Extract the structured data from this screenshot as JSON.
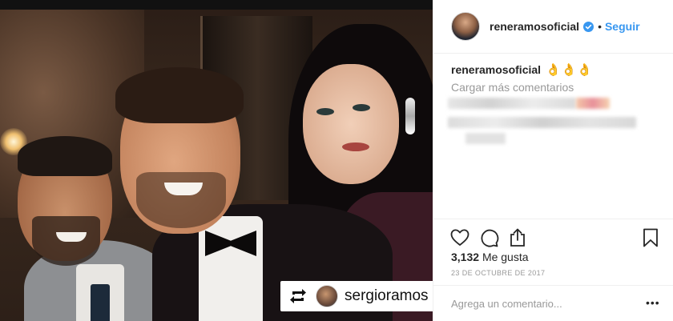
{
  "post": {
    "repost_username": "sergioramos"
  },
  "header": {
    "username": "reneramosoficial",
    "separator": "•",
    "follow_label": "Seguir"
  },
  "caption": {
    "username": "reneramosoficial",
    "emojis": "👌👌👌"
  },
  "comments": {
    "load_more_label": "Cargar más comentarios"
  },
  "stats": {
    "likes_count": "3,132",
    "likes_label": "Me gusta",
    "date": "23 DE OCTUBRE DE 2017"
  },
  "comment_box": {
    "placeholder": "Agrega un comentario..."
  },
  "colors": {
    "link_blue": "#3897f0",
    "muted_text": "#999999",
    "border": "#efefef"
  },
  "icons": [
    "repost-icon",
    "verified-badge-icon",
    "heart-icon",
    "comment-icon",
    "share-icon",
    "bookmark-icon",
    "more-options-icon"
  ]
}
